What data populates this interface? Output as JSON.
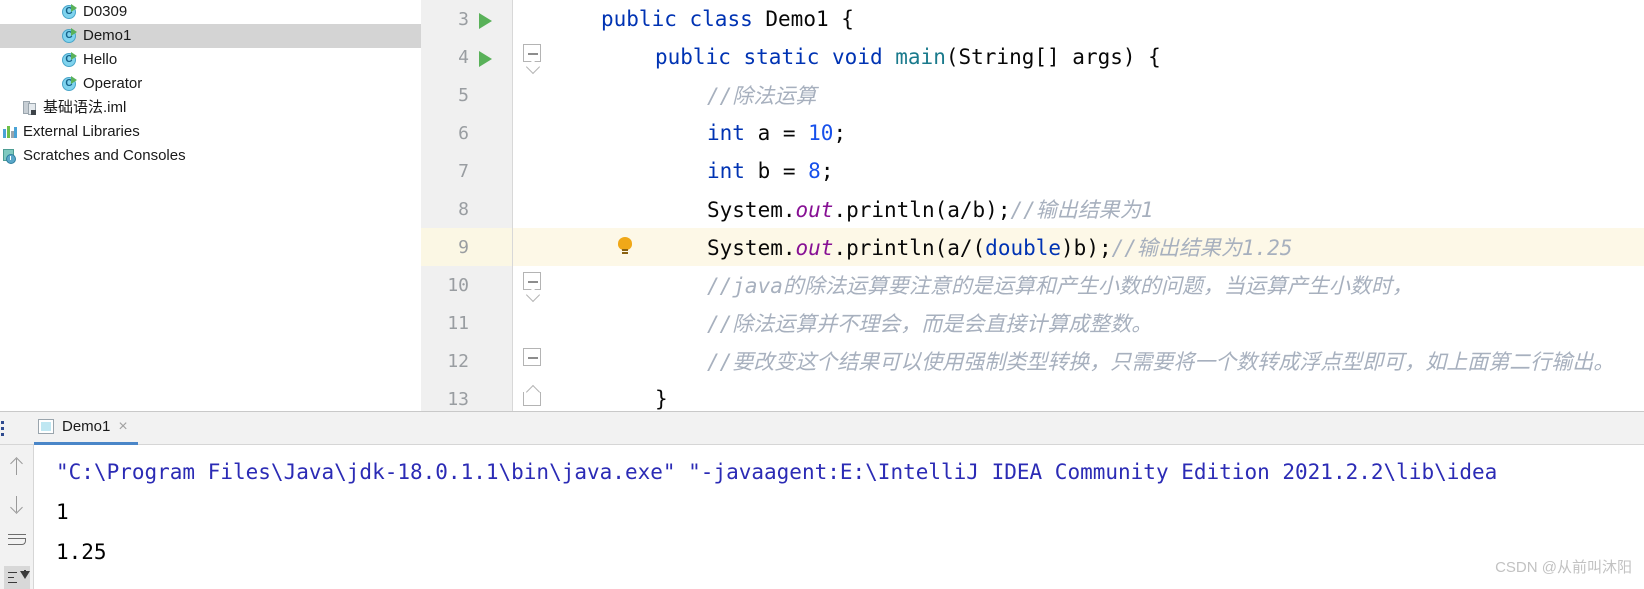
{
  "project_tree": {
    "items": [
      {
        "label": "D0309",
        "icon": "java-class-icon",
        "indent": 62,
        "selected": false
      },
      {
        "label": "Demo1",
        "icon": "java-class-icon",
        "indent": 62,
        "selected": true
      },
      {
        "label": "Hello",
        "icon": "java-class-icon",
        "indent": 62,
        "selected": false
      },
      {
        "label": "Operator",
        "icon": "java-class-icon",
        "indent": 62,
        "selected": false
      },
      {
        "label": "基础语法.iml",
        "icon": "iml-file-icon",
        "indent": 22,
        "selected": false
      },
      {
        "label": "External Libraries",
        "icon": "libraries-icon",
        "indent": 2,
        "selected": false
      },
      {
        "label": "Scratches and Consoles",
        "icon": "scratches-icon",
        "indent": 2,
        "selected": false
      }
    ]
  },
  "editor": {
    "lines": [
      {
        "no": "3",
        "run": true,
        "fold": "none",
        "bulb": false,
        "highlight": false
      },
      {
        "no": "4",
        "run": true,
        "fold": "minus",
        "bulb": false,
        "highlight": false
      },
      {
        "no": "5",
        "run": false,
        "fold": "none",
        "bulb": false,
        "highlight": false
      },
      {
        "no": "6",
        "run": false,
        "fold": "none",
        "bulb": false,
        "highlight": false
      },
      {
        "no": "7",
        "run": false,
        "fold": "none",
        "bulb": false,
        "highlight": false
      },
      {
        "no": "8",
        "run": false,
        "fold": "none",
        "bulb": false,
        "highlight": false
      },
      {
        "no": "9",
        "run": false,
        "fold": "none",
        "bulb": true,
        "highlight": true
      },
      {
        "no": "10",
        "run": false,
        "fold": "minus",
        "bulb": false,
        "highlight": false
      },
      {
        "no": "11",
        "run": false,
        "fold": "none",
        "bulb": false,
        "highlight": false
      },
      {
        "no": "12",
        "run": false,
        "fold": "minus",
        "bulb": false,
        "highlight": false
      },
      {
        "no": "13",
        "run": false,
        "fold": "end",
        "bulb": false,
        "highlight": false
      }
    ],
    "code": {
      "l3_kw_public": "public",
      "l3_kw_class": "class",
      "l3_name": "Demo1",
      "l3_brace": "{",
      "l4_public": "public",
      "l4_static": "static",
      "l4_void": "void",
      "l4_main": "main",
      "l4_paren_open": "(",
      "l4_string": "String",
      "l4_brackets": "[]",
      "l4_args": " args",
      "l4_tail": ") {",
      "l5_comment": "//除法运算",
      "l6_int": "int",
      "l6_var": " a = ",
      "l6_num": "10",
      "l6_semi": ";",
      "l7_int": "int",
      "l7_var": " b = ",
      "l7_num": "8",
      "l7_semi": ";",
      "l8_system": "System.",
      "l8_out": "out",
      "l8_call": ".println(a/b);",
      "l8_comment": "//输出结果为1",
      "l9_system": "System.",
      "l9_out": "out",
      "l9_pre": ".println(a/(",
      "l9_double": "double",
      "l9_post": ")b);",
      "l9_comment": "//输出结果为1.25",
      "l10_comment": "//java的除法运算要注意的是运算和产生小数的问题，当运算产生小数时，",
      "l11_comment": "//除法运算并不理会，而是会直接计算成整数。",
      "l12_comment": "//要改变这个结果可以使用强制类型转换，只需要将一个数转成浮点型即可，如上面第二行输出。",
      "l13_brace": "}"
    }
  },
  "console": {
    "tab_label": "Demo1",
    "tab_close": "×",
    "toolbar": [
      {
        "name": "scroll-up-button",
        "active": false
      },
      {
        "name": "scroll-down-button",
        "active": false
      },
      {
        "name": "soft-wrap-button",
        "active": false
      },
      {
        "name": "scroll-to-end-button",
        "active": true
      }
    ],
    "output": [
      {
        "text": "\"C:\\Program Files\\Java\\jdk-18.0.1.1\\bin\\java.exe\" \"-javaagent:E:\\IntelliJ IDEA Community Edition 2021.2.2\\lib\\idea",
        "kind": "command"
      },
      {
        "text": "1",
        "kind": "value"
      },
      {
        "text": "1.25",
        "kind": "value"
      }
    ]
  },
  "watermark": {
    "text": "CSDN @从前叫沐阳"
  },
  "colors": {
    "selection": "#d4d4d4",
    "line_highlight": "#fdf8e7",
    "gutter": "#f0f0f0",
    "keyword": "#0033b3",
    "number": "#1750eb",
    "field": "#871094",
    "comment": "#8c8c8c",
    "comment_cn": "#a7b0be",
    "console_command": "#2b2bb5",
    "tab_underline": "#4a86c8",
    "run_arrow": "#59b159",
    "bulb": "#f0a818"
  }
}
